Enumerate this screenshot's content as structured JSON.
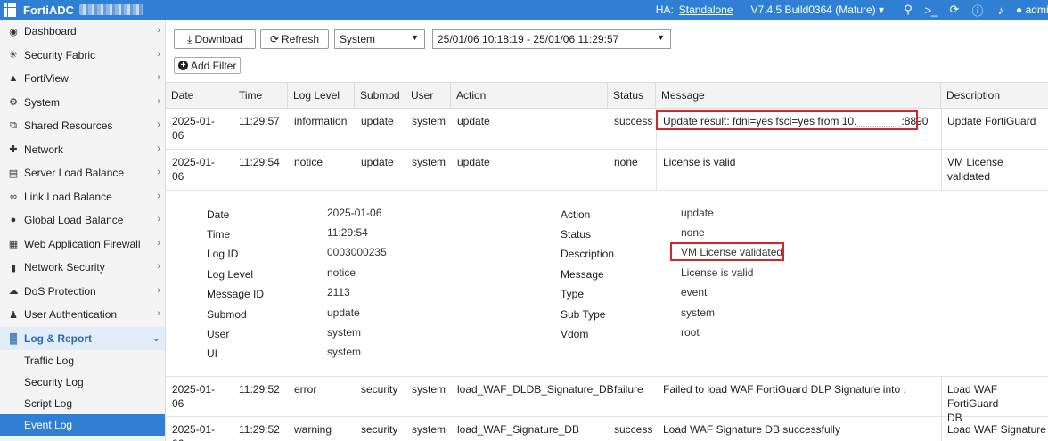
{
  "header": {
    "brand": "FortiADC",
    "ha_label": "HA:",
    "ha_value": "Standalone",
    "version": "V7.4.5 Build0364 (Mature)",
    "user": "admin",
    "icons": [
      "search-icon",
      "terminal-icon",
      "refresh-icon",
      "help-icon",
      "bell-icon",
      "user-icon"
    ]
  },
  "sidebar": {
    "items": [
      {
        "label": "Dashboard",
        "icon": "dashboard-icon"
      },
      {
        "label": "Security Fabric",
        "icon": "fabric-icon"
      },
      {
        "label": "FortiView",
        "icon": "chart-icon"
      },
      {
        "label": "System",
        "icon": "gear-icon"
      },
      {
        "label": "Shared Resources",
        "icon": "share-icon"
      },
      {
        "label": "Network",
        "icon": "network-icon"
      },
      {
        "label": "Server Load Balance",
        "icon": "server-icon"
      },
      {
        "label": "Link Load Balance",
        "icon": "link-icon"
      },
      {
        "label": "Global Load Balance",
        "icon": "globe-icon"
      },
      {
        "label": "Web Application Firewall",
        "icon": "firewall-icon"
      },
      {
        "label": "Network Security",
        "icon": "shield-icon"
      },
      {
        "label": "DoS Protection",
        "icon": "cloud-icon"
      },
      {
        "label": "User Authentication",
        "icon": "user-icon"
      },
      {
        "label": "Log & Report",
        "icon": "report-icon"
      }
    ],
    "subitems": [
      "Traffic Log",
      "Security Log",
      "Script Log",
      "Event Log"
    ]
  },
  "toolbar": {
    "download_label": "Download",
    "refresh_label": "Refresh",
    "category_value": "System",
    "range_value": "25/01/06 10:18:19 - 25/01/06 11:29:57",
    "add_filter_label": "Add Filter"
  },
  "table": {
    "headers": [
      "Date",
      "Time",
      "Log Level",
      "Submod",
      "User",
      "Action",
      "Status",
      "Message",
      "Description"
    ],
    "rows": [
      {
        "date1": "2025-01-",
        "date2": "06",
        "time": "11:29:57",
        "level": "information",
        "submod": "update",
        "user": "system",
        "action": "update",
        "status": "success",
        "message_a": "Update result: fdni=yes fsci=yes from 10.",
        "message_b": ":8890",
        "description": "Update FortiGuard"
      },
      {
        "date1": "2025-01-",
        "date2": "06",
        "time": "11:29:54",
        "level": "notice",
        "submod": "update",
        "user": "system",
        "action": "update",
        "status": "none",
        "message": "License is valid",
        "description": "VM License validated"
      },
      {
        "date1": "2025-01-",
        "date2": "06",
        "time": "11:29:52",
        "level": "error",
        "submod": "security",
        "user": "system",
        "action": "load_WAF_DLDB_Signature_DB",
        "status": "failure",
        "message": "Failed to load WAF FortiGuard DLP Signature into .",
        "description1": "Load WAF FortiGuard",
        "description2": "DB"
      },
      {
        "date1": "2025-01-",
        "date2": "06",
        "time": "11:29:52",
        "level": "warning",
        "submod": "security",
        "user": "system",
        "action": "load_WAF_Signature_DB",
        "status": "success",
        "message": "Load WAF Signature DB successfully",
        "description": "Load WAF Signature D"
      }
    ]
  },
  "detail": {
    "left": [
      {
        "label": "Date",
        "value": "2025-01-06"
      },
      {
        "label": "Time",
        "value": "11:29:54"
      },
      {
        "label": "Log ID",
        "value": "0003000235"
      },
      {
        "label": "Log Level",
        "value": "notice"
      },
      {
        "label": "Message ID",
        "value": "2113"
      },
      {
        "label": "Submod",
        "value": "update"
      },
      {
        "label": "User",
        "value": "system"
      },
      {
        "label": "UI",
        "value": "system"
      }
    ],
    "right": [
      {
        "label": "Action",
        "value": "update"
      },
      {
        "label": "Status",
        "value": "none"
      },
      {
        "label": "Description",
        "value": "VM License validated"
      },
      {
        "label": "Message",
        "value": "License is valid"
      },
      {
        "label": "Type",
        "value": "event"
      },
      {
        "label": "Sub Type",
        "value": "system"
      },
      {
        "label": "Vdom",
        "value": "root"
      }
    ]
  },
  "colors": {
    "accent": "#2f7fd4",
    "highlight": "#d3262d"
  }
}
